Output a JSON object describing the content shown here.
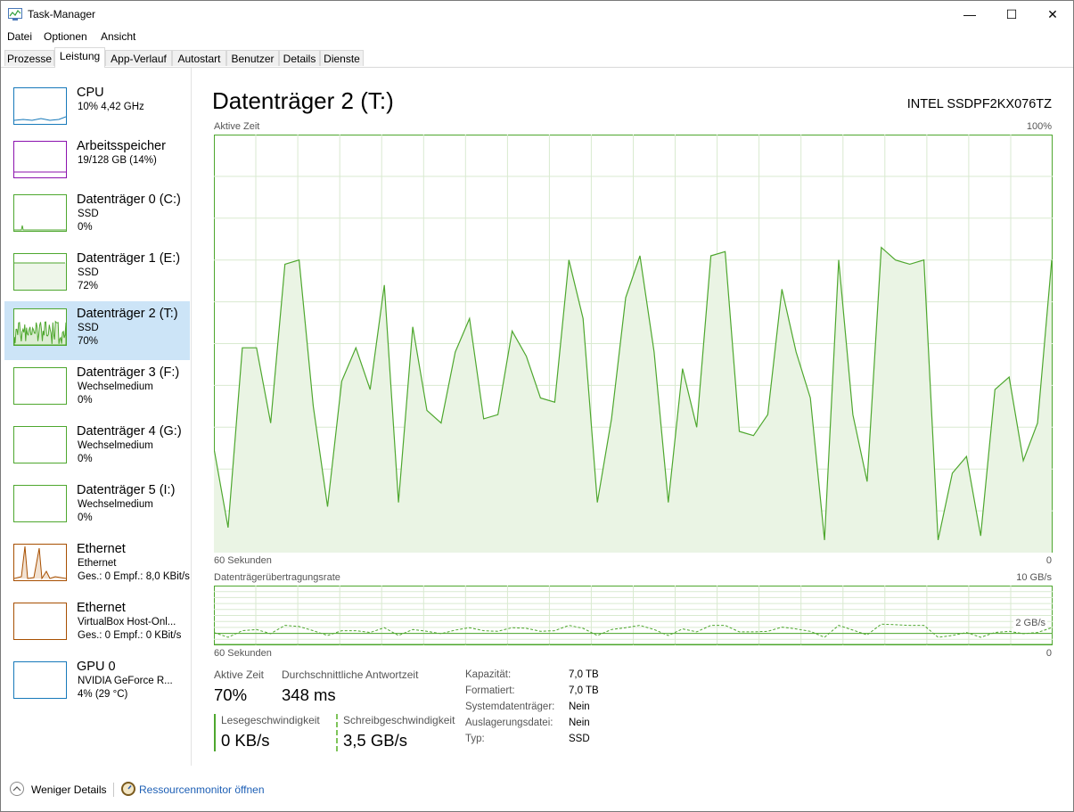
{
  "window": {
    "title": "Task-Manager",
    "minimize": "—",
    "maximize": "☐",
    "close": "✕"
  },
  "menu": [
    "Datei",
    "Optionen",
    "Ansicht"
  ],
  "tabs": [
    "Prozesse",
    "Leistung",
    "App-Verlauf",
    "Autostart",
    "Benutzer",
    "Details",
    "Dienste"
  ],
  "active_tab": "Leistung",
  "sidebar": [
    {
      "name": "CPU",
      "line1": "10% 4,42 GHz",
      "line2": "",
      "color": "#1779ba",
      "icon": "cpu-graph"
    },
    {
      "name": "Arbeitsspeicher",
      "line1": "19/128 GB (14%)",
      "line2": "",
      "color": "#8b12ae",
      "icon": "memory-graph"
    },
    {
      "name": "Datenträger 0 (C:)",
      "line1": "SSD",
      "line2": "0%",
      "color": "#4ea72e",
      "icon": "disk-graph"
    },
    {
      "name": "Datenträger 1 (E:)",
      "line1": "SSD",
      "line2": "72%",
      "color": "#4ea72e",
      "icon": "disk-graph"
    },
    {
      "name": "Datenträger 2 (T:)",
      "line1": "SSD",
      "line2": "70%",
      "color": "#4ea72e",
      "icon": "disk-graph",
      "selected": true
    },
    {
      "name": "Datenträger 3 (F:)",
      "line1": "Wechselmedium",
      "line2": "0%",
      "color": "#4ea72e",
      "icon": "disk-graph"
    },
    {
      "name": "Datenträger 4 (G:)",
      "line1": "Wechselmedium",
      "line2": "0%",
      "color": "#4ea72e",
      "icon": "disk-graph"
    },
    {
      "name": "Datenträger 5 (I:)",
      "line1": "Wechselmedium",
      "line2": "0%",
      "color": "#4ea72e",
      "icon": "disk-graph"
    },
    {
      "name": "Ethernet",
      "line1": "Ethernet",
      "line2": "Ges.: 0 Empf.: 8,0 KBit/s",
      "color": "#a74f01",
      "icon": "network-graph"
    },
    {
      "name": "Ethernet",
      "line1": "VirtualBox Host-Onl...",
      "line2": "Ges.: 0 Empf.: 0 KBit/s",
      "color": "#a74f01",
      "icon": "network-graph"
    },
    {
      "name": "GPU 0",
      "line1": "NVIDIA GeForce R...",
      "line2": "4% (29 °C)",
      "color": "#1779ba",
      "icon": "gpu-graph"
    }
  ],
  "main": {
    "title": "Datenträger 2 (T:)",
    "model": "INTEL SSDPF2KX076TZ",
    "graph1": {
      "label": "Aktive Zeit",
      "max": "100%",
      "xleft": "60 Sekunden",
      "xright": "0"
    },
    "graph2": {
      "label": "Datenträgerübertragungsrate",
      "max": "10 GB/s",
      "mid": "2 GB/s",
      "xleft": "60 Sekunden",
      "xright": "0"
    }
  },
  "stats": {
    "active_time_label": "Aktive Zeit",
    "active_time_value": "70%",
    "avg_response_label": "Durchschnittliche Antwortzeit",
    "avg_response_value": "348 ms",
    "read_label": "Lesegeschwindigkeit",
    "read_value": "0 KB/s",
    "write_label": "Schreibgeschwindigkeit",
    "write_value": "3,5 GB/s"
  },
  "properties": [
    {
      "label": "Kapazität:",
      "value": "7,0 TB"
    },
    {
      "label": "Formatiert:",
      "value": "7,0 TB"
    },
    {
      "label": "Systemdatenträger:",
      "value": "Nein"
    },
    {
      "label": "Auslagerungsdatei:",
      "value": "Nein"
    },
    {
      "label": "Typ:",
      "value": "SSD"
    }
  ],
  "footer": {
    "fewer_details": "Weniger Details",
    "resource_monitor": "Ressourcenmonitor öffnen"
  },
  "chart_data": [
    {
      "type": "area",
      "title": "Aktive Zeit",
      "ylim": [
        0,
        100
      ],
      "x_label_left": "60 Sekunden",
      "x_label_right": "0",
      "series": [
        {
          "values": [
            25,
            6,
            49,
            49,
            31,
            69,
            70,
            35,
            11,
            41,
            49,
            39,
            64,
            12,
            54,
            34,
            31,
            48,
            56,
            32,
            33,
            53,
            47,
            37,
            36,
            70,
            56,
            12,
            32,
            61,
            71,
            48,
            12,
            44,
            30,
            71,
            72,
            29,
            28,
            33,
            63,
            48,
            37,
            3,
            70,
            33,
            17,
            73,
            70,
            69,
            70,
            3,
            19,
            23,
            4,
            39,
            42,
            22,
            31,
            70
          ]
        }
      ],
      "color": "#4ea72e"
    },
    {
      "type": "line",
      "title": "Datenträgerübertragungsrate",
      "ylim": [
        0,
        10
      ],
      "unit": "GB/s",
      "reference_line": 2,
      "x_label_left": "60 Sekunden",
      "x_label_right": "0",
      "series": [
        {
          "style": "dashed",
          "values": [
            2.0,
            1.2,
            2.3,
            2.5,
            1.8,
            3.2,
            3.0,
            2.3,
            1.5,
            2.3,
            2.3,
            2.0,
            2.8,
            1.5,
            2.5,
            2.2,
            1.8,
            2.4,
            2.8,
            2.3,
            2.2,
            2.8,
            2.7,
            2.2,
            2.3,
            3.2,
            2.7,
            1.5,
            2.5,
            2.8,
            3.2,
            2.5,
            1.5,
            2.6,
            2.1,
            3.2,
            3.2,
            2.1,
            2.1,
            2.2,
            2.9,
            2.6,
            2.2,
            1.2,
            3.2,
            2.4,
            1.6,
            3.4,
            3.3,
            3.2,
            3.2,
            1.2,
            1.5,
            2.0,
            1.2,
            2.0,
            2.2,
            1.8,
            2.0,
            2.8
          ]
        },
        {
          "style": "solid",
          "values": [
            0,
            0,
            0,
            0,
            0,
            0,
            0,
            0,
            0,
            0,
            0,
            0,
            0,
            0,
            0,
            0,
            0,
            0,
            0,
            0,
            0,
            0,
            0,
            0,
            0,
            0,
            0,
            0,
            0,
            0,
            0,
            0,
            0,
            0,
            0,
            0,
            0,
            0,
            0,
            0,
            0,
            0,
            0,
            0,
            0,
            0,
            0,
            0,
            0,
            0,
            0,
            0,
            0,
            0,
            0,
            0,
            0,
            0,
            0,
            0
          ]
        }
      ],
      "color": "#4ea72e"
    }
  ]
}
